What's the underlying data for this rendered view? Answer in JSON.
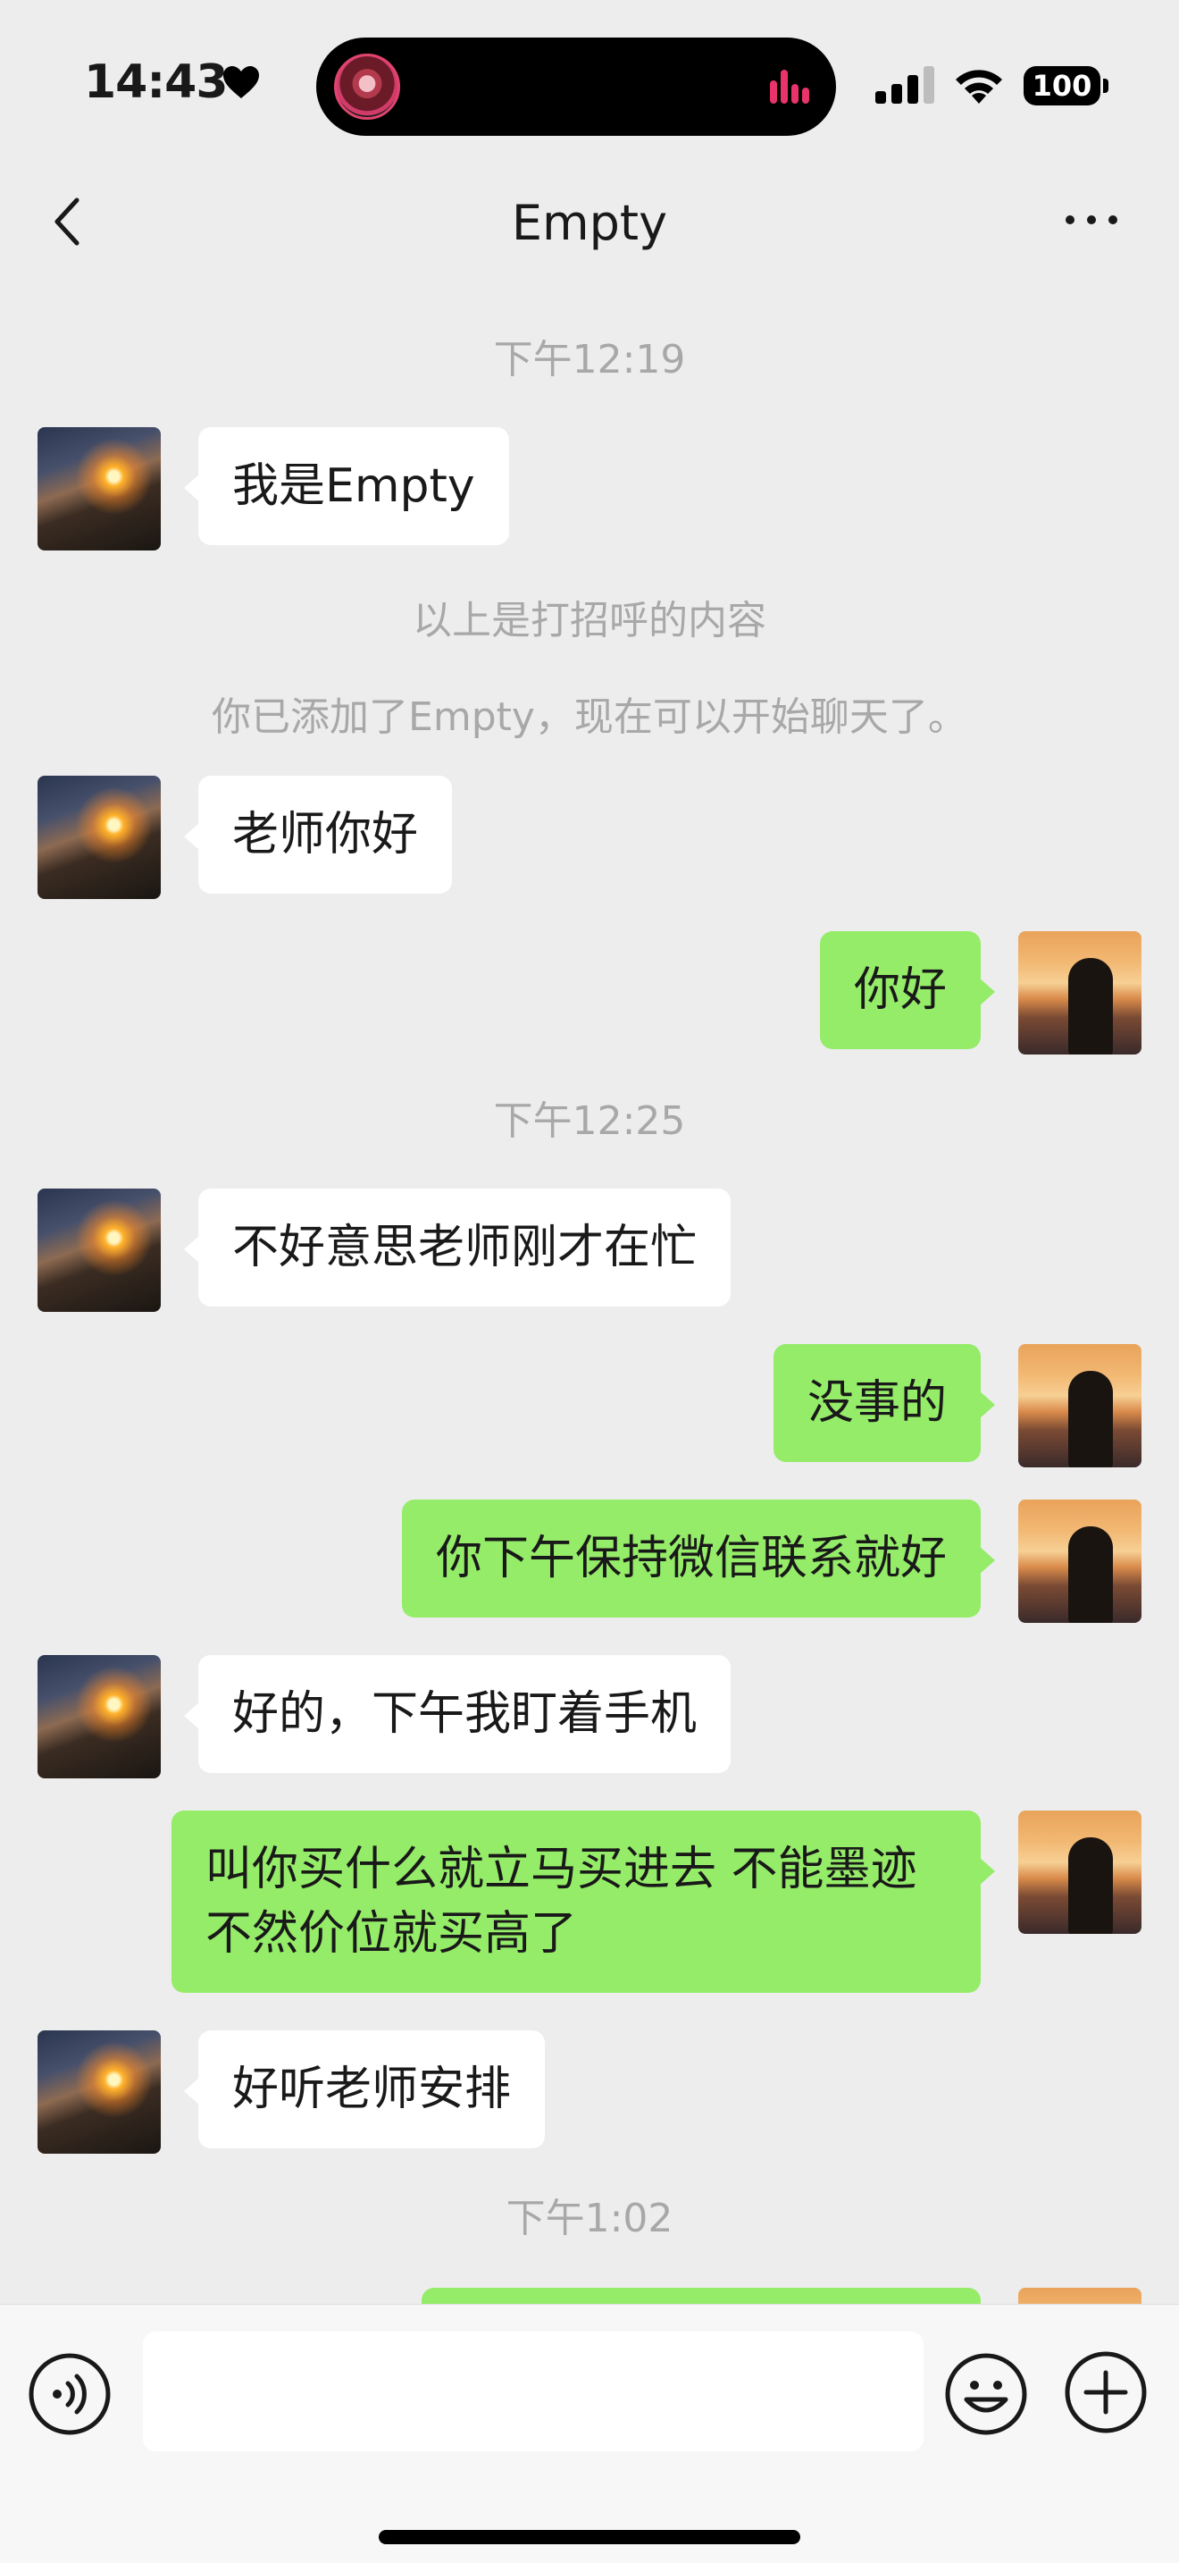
{
  "status_bar": {
    "time": "14:43",
    "battery": "100"
  },
  "nav": {
    "title": "Empty"
  },
  "chat": {
    "timestamps": [
      "下午12:19",
      "下午12:25",
      "下午1:02"
    ],
    "system_messages": [
      "以上是打招呼的内容",
      "你已添加了Empty，现在可以开始聊天了。"
    ],
    "messages": [
      {
        "side": "left",
        "text": "我是Empty"
      },
      {
        "side": "left",
        "text": "老师你好"
      },
      {
        "side": "right",
        "text": "你好"
      },
      {
        "side": "left",
        "text": "不好意思老师刚才在忙"
      },
      {
        "side": "right",
        "text": "没事的"
      },
      {
        "side": "right",
        "text": "你下午保持微信联系就好"
      },
      {
        "side": "left",
        "text": "好的，下午我盯着手机"
      },
      {
        "side": "right",
        "text": "叫你买什么就立马买进去 不能墨迹不然价位就买高了"
      },
      {
        "side": "left",
        "text": "好听老师安排"
      }
    ]
  },
  "input_bar": {
    "icons": [
      "voice-icon",
      "emoji-icon",
      "plus-icon"
    ]
  },
  "colors": {
    "background": "#ededed",
    "outgoing_bubble": "#95ec69",
    "incoming_bubble": "#ffffff"
  }
}
